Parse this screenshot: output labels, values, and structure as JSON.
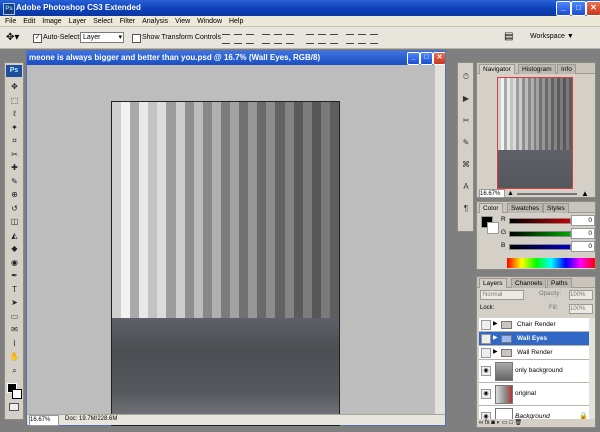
{
  "app": {
    "title": "Adobe Photoshop CS3 Extended",
    "logo": "Ps"
  },
  "window_controls": {
    "minimize": "_",
    "maximize": "□",
    "close": "✕"
  },
  "menu": [
    "File",
    "Edit",
    "Image",
    "Layer",
    "Select",
    "Filter",
    "Analysis",
    "View",
    "Window",
    "Help"
  ],
  "options_bar": {
    "auto_select_label": "Auto-Select:",
    "auto_select_checked": true,
    "auto_select_value": "Layer",
    "transform_label": "Show Transform Controls",
    "transform_checked": false,
    "workspace_label": "Workspace ▼"
  },
  "document": {
    "title": "meone is always bigger and better than you.psd @ 16.7% (Wall Eyes, RGB/8)",
    "zoom": "16.67%",
    "doc_info": "Doc: 19.7M/228.6M",
    "stripe_shades": [
      "#cfcfcf",
      "#f2f2f2",
      "#a9a9a9",
      "#e9e9e9",
      "#c3c3c3",
      "#dcdcdc",
      "#9d9d9d",
      "#cdcdcd",
      "#8e8e8e",
      "#bcbcbc",
      "#888888",
      "#b0b0b0",
      "#7c7c7c",
      "#a3a3a3",
      "#717171",
      "#969696",
      "#6a6a6a",
      "#8d8d8d",
      "#626262",
      "#848484",
      "#5b5b5b",
      "#7c7c7c",
      "#575757",
      "#7a7a7a",
      "#5e5e5e"
    ]
  },
  "icons": {
    "tools": [
      "move-icon",
      "marquee-icon",
      "lasso-icon",
      "magic-wand-icon",
      "crop-icon",
      "slice-icon",
      "healing-brush-icon",
      "brush-icon",
      "clone-stamp-icon",
      "history-brush-icon",
      "eraser-icon",
      "paint-bucket-icon",
      "blur-icon",
      "dodge-icon",
      "pen-icon",
      "type-icon",
      "path-selection-icon",
      "shape-icon",
      "notes-icon",
      "eyedropper-icon",
      "hand-icon",
      "zoom-icon"
    ],
    "strip": [
      "history-icon",
      "actions-icon",
      "tools-preset-icon",
      "brushes-icon",
      "clone-source-icon",
      "character-icon",
      "paragraph-icon"
    ]
  },
  "navigator": {
    "tabs": [
      "Navigator",
      "Histogram",
      "Info"
    ],
    "zoom": "16.67%"
  },
  "color_panel": {
    "tabs": [
      "Color",
      "Swatches",
      "Styles"
    ],
    "channels": [
      {
        "label": "R",
        "value": "0",
        "color": "#cc0000"
      },
      {
        "label": "G",
        "value": "0",
        "color": "#00aa00"
      },
      {
        "label": "B",
        "value": "0",
        "color": "#0000cc"
      }
    ]
  },
  "layers_panel": {
    "tabs": [
      "Layers",
      "Channels",
      "Paths"
    ],
    "blend_mode": "Normal",
    "opacity_label": "Opacity:",
    "opacity_value": "100%",
    "lock_label": "Lock:",
    "fill_label": "Fill:",
    "fill_value": "100%",
    "layers": [
      {
        "name": "Chair Render",
        "kind": "group",
        "visible": false,
        "selected": false
      },
      {
        "name": "Wall Eyes",
        "kind": "group",
        "visible": false,
        "selected": true
      },
      {
        "name": "Wall Render",
        "kind": "group",
        "visible": false,
        "selected": false
      },
      {
        "name": "only background",
        "kind": "layer",
        "visible": true,
        "selected": false
      },
      {
        "name": "original",
        "kind": "layer",
        "visible": true,
        "selected": false
      },
      {
        "name": "Background",
        "kind": "layer",
        "visible": true,
        "selected": false,
        "locked": true
      }
    ]
  }
}
